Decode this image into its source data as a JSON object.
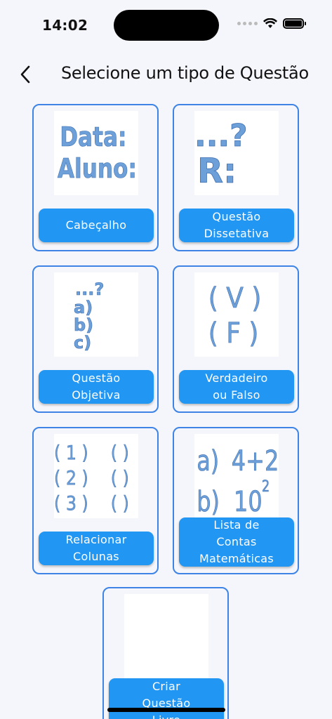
{
  "status_bar": {
    "time": "14:02",
    "icons": [
      "signal-dots-icon",
      "wifi-icon",
      "battery-icon"
    ]
  },
  "header": {
    "back_icon": "chevron-left-icon",
    "title": "Selecione um tipo de Questão"
  },
  "colors": {
    "accent": "#2196f3",
    "card_border": "#3d84e6",
    "thumb_text": "#6d9fd8",
    "background": "#f5f6fb"
  },
  "cards": [
    {
      "label": "Cabeçalho",
      "thumb": {
        "line1": "Data:",
        "line2": "Aluno:"
      }
    },
    {
      "label": "Questão\nDissetativa",
      "thumb": {
        "line1": "...?",
        "line2": "R:"
      }
    },
    {
      "label": "Questão\nObjetiva",
      "thumb": {
        "line1": "...?",
        "line2": "a)",
        "line3": "b)",
        "line4": "c)"
      }
    },
    {
      "label": "Verdadeiro\nou Falso",
      "thumb": {
        "line1": "( V )",
        "line2": "( F )"
      }
    },
    {
      "label": "Relacionar\nColunas",
      "thumb": {
        "row1a": "( 1 )",
        "row1b": "(  )",
        "row2a": "( 2 )",
        "row2b": "(  )",
        "row3a": "( 3 )",
        "row3b": "(  )"
      }
    },
    {
      "label": "Lista de\nContas\nMatemáticas",
      "thumb": {
        "line1a": "a)",
        "line1b": "4+2",
        "line2a": "b)",
        "line2b": "10",
        "line2sup": "2"
      }
    },
    {
      "label": "Criar\nQuestão\nLivre"
    }
  ]
}
